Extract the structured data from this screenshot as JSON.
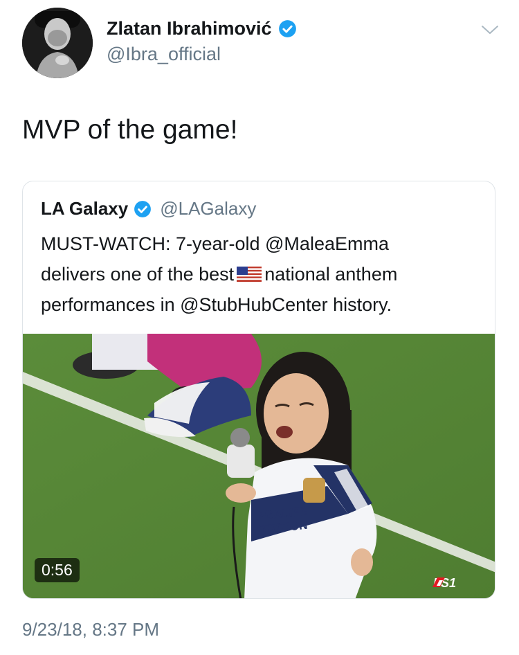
{
  "author": {
    "name": "Zlatan Ibrahimović",
    "handle": "@Ibra_official",
    "verified": true,
    "avatar_icon": "avatar-photo"
  },
  "tweet": {
    "text": "MVP of the game!",
    "timestamp": "9/23/18, 8:37 PM"
  },
  "quoted_tweet": {
    "name": "LA Galaxy",
    "handle": "@LAGalaxy",
    "verified": true,
    "text_lines": [
      "MUST-WATCH: 7-year-old @MaleaEmma",
      "delivers one of the best",
      "national anthem",
      "performances in @StubHubCenter history."
    ],
    "inline_icon": "us-flag-emoji",
    "video": {
      "duration": "0:56",
      "network_logo": "FS1",
      "jersey_text_1": "RBALIFE",
      "jersey_text_2": "UTRITION"
    }
  },
  "colors": {
    "text_primary": "#14171a",
    "text_secondary": "#657786",
    "verified_blue": "#1da1f2",
    "card_border": "#dfe4e8"
  }
}
